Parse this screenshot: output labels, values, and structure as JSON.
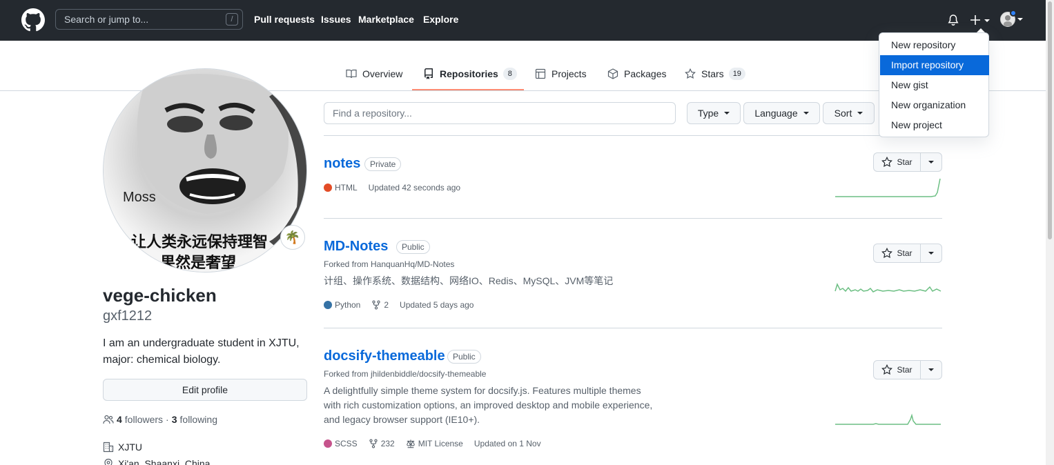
{
  "header": {
    "search_placeholder": "Search or jump to...",
    "search_shortcut": "/",
    "nav": [
      "Pull requests",
      "Issues",
      "Marketplace",
      "Explore"
    ]
  },
  "tabs": [
    {
      "label": "Overview",
      "icon": "book-icon"
    },
    {
      "label": "Repositories",
      "icon": "repo-icon",
      "count": "8",
      "active": true
    },
    {
      "label": "Projects",
      "icon": "project-icon"
    },
    {
      "label": "Packages",
      "icon": "package-icon"
    },
    {
      "label": "Stars",
      "icon": "star-icon",
      "count": "19"
    }
  ],
  "profile": {
    "avatar_caption_top": "Moss",
    "avatar_caption_cn1": "让人类永远保持理智",
    "avatar_caption_cn2": "果然是奢望",
    "status_emoji": "🌴",
    "fullname": "vege-chicken",
    "username": "gxf1212",
    "bio": "I am an undergraduate student in XJTU, major: chemical biology.",
    "edit_button": "Edit profile",
    "followers_count": "4",
    "followers_label": "followers",
    "separator": "·",
    "following_count": "3",
    "following_label": "following",
    "organization": "XJTU",
    "location": "Xi'an, Shaanxi, China"
  },
  "filters": {
    "find_placeholder": "Find a repository...",
    "type": "Type",
    "language": "Language",
    "sort": "Sort"
  },
  "dropdown": {
    "items": [
      "New repository",
      "Import repository",
      "New gist",
      "New organization",
      "New project"
    ],
    "highlighted_index": 1
  },
  "repos": [
    {
      "name": "notes",
      "visibility": "Private",
      "language": "HTML",
      "language_color": "#e34c26",
      "updated": "Updated 42 seconds ago",
      "star_label": "Star"
    },
    {
      "name": "MD-Notes",
      "visibility": "Public",
      "forked_from": "Forked from HanquanHq/MD-Notes",
      "description": "计组、操作系统、数据结构、网络IO、Redis、MySQL、JVM等笔记",
      "language": "Python",
      "language_color": "#3572a5",
      "forks": "2",
      "updated": "Updated 5 days ago",
      "star_label": "Star"
    },
    {
      "name": "docsify-themeable",
      "visibility": "Public",
      "forked_from": "Forked from jhildenbiddle/docsify-themeable",
      "description_lines": [
        "A delightfully simple theme system for docsify.js. Features multiple themes",
        "with rich customization options, an improved desktop and mobile experience,",
        "and legacy browser support (IE10+)."
      ],
      "language": "SCSS",
      "language_color": "#c6538c",
      "forks": "232",
      "license": "MIT License",
      "updated": "Updated on 1 Nov",
      "star_label": "Star"
    }
  ],
  "colors": {
    "header_bg": "#24292f",
    "link_blue": "#0969da",
    "tab_underline": "#fd8c73",
    "spark_green": "#2da44e"
  }
}
